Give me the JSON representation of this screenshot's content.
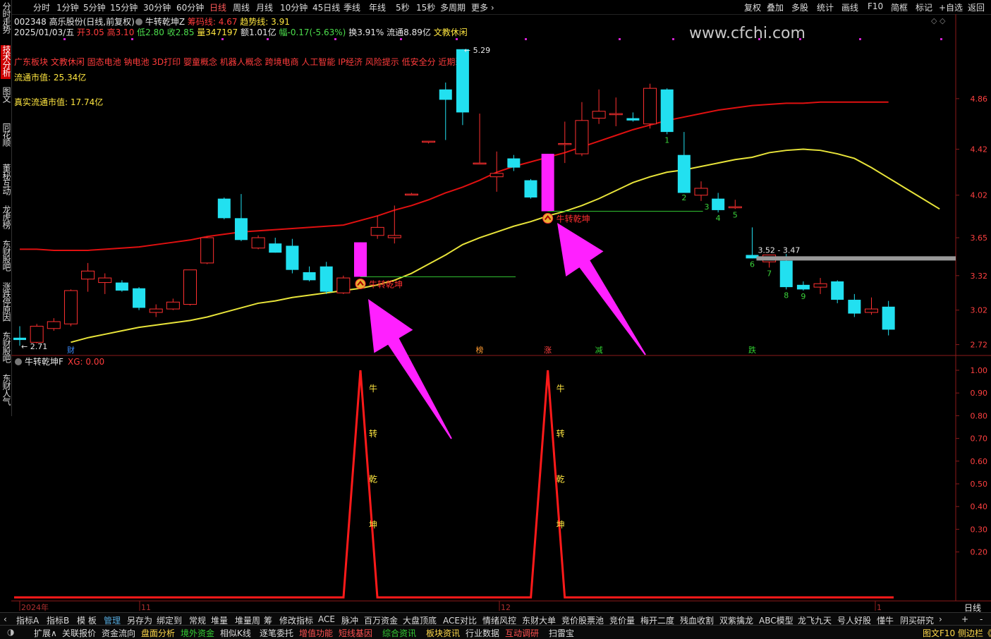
{
  "toolbar": {
    "periods": [
      "分时",
      "1分钟",
      "5分钟",
      "15分钟",
      "30分钟",
      "60分钟",
      "日线",
      "周线",
      "月线",
      "10分钟",
      "45日线",
      "季线",
      "年线",
      "5秒",
      "15秒",
      "多周期",
      "更多"
    ],
    "active_period": "日线",
    "right_buttons": [
      "复权",
      "叠加",
      "多股",
      "统计",
      "画线",
      "F10",
      "简框",
      "标记",
      "+自选",
      "返回"
    ]
  },
  "sidenav": {
    "items": [
      "分时走势",
      "技术分析",
      "图文10",
      "同花顺10",
      "董秘互动",
      "龙虎榜",
      "东财股吧",
      "涨跌停原因",
      "东财股吧",
      "东财人气"
    ],
    "active": "技术分析"
  },
  "stock": {
    "code_name": "002348 高乐股份(日线,前复权)",
    "indicator_title": "牛转乾坤Z",
    "chip_line_label": "筹码线: 4.67",
    "trend_line_label": "趋势线: 3.91",
    "date": "2025/01/03/五",
    "open": "开3.05",
    "high": "高3.10",
    "low": "低2.80",
    "close": "收2.85",
    "volume": "量347197",
    "amount": "额1.01亿",
    "change": "幅-0.17(-5.63%)",
    "turnover": "换3.91%",
    "float_cap": "流通8.89亿",
    "sector": "文教休闲",
    "concepts": "广东板块 文教休闲 固态电池 钠电池 3D打印 婴童概念 机器人概念 跨境电商 人工智能 IP经济 风险提示 低安全分 近期弱",
    "float_mv": "流通市值: 25.34亿",
    "real_float_mv": "真实流通市值: 17.74亿",
    "watermark": "www.cfchi.com"
  },
  "main_chart": {
    "price_ticks": [
      "4.86",
      "4.42",
      "4.02",
      "3.65",
      "3.32",
      "3.02",
      "2.72"
    ],
    "high_label": "5.29",
    "low_label": "2.71",
    "range_label": "3.52 - 3.47",
    "signal_label": "牛转乾坤",
    "markers": [
      "财",
      "榜",
      "涨",
      "减",
      "跌"
    ],
    "counts": [
      "1",
      "2",
      "3",
      "4",
      "5",
      "6",
      "7",
      "8",
      "9"
    ]
  },
  "sub_chart": {
    "title": "牛转乾坤F",
    "xg_label": "XG: 0.00",
    "ticks": [
      "1.00",
      "0.90",
      "0.80",
      "0.70",
      "0.60",
      "0.50",
      "0.40",
      "0.30",
      "0.20"
    ],
    "peak_chars": [
      "牛",
      "转",
      "乾",
      "坤"
    ]
  },
  "time_axis": {
    "labels": [
      "2024年",
      "11",
      "12",
      "1"
    ],
    "period_button": "日线"
  },
  "indicator_tabs": [
    "指标A",
    "指标B",
    "模 板",
    "管理",
    "另存为",
    "绑定到",
    "常规",
    "堆量",
    "堆量周",
    "筹",
    "修改指标",
    "ACE",
    "脉冲",
    "百万资金",
    "大盘顶底",
    "ACE对比",
    "情绪风控",
    "东财大单",
    "竞价股票池",
    "竞价量",
    "梅开二度",
    "残血收割",
    "双紫擒龙",
    "ABC模型",
    "龙飞九天",
    "号人好股",
    "懂牛",
    "阴买研究"
  ],
  "active_indicator_tab": "管理",
  "bottom_bar": {
    "items": [
      "扩展∧",
      "关联报价",
      "资金流向",
      "盘面分析",
      "境外资金",
      "相似K线",
      "逐笔委托",
      "增值功能",
      "短线基因",
      "综合资讯",
      "板块资讯",
      "行业数据",
      "互动调研",
      "扫雷宝"
    ],
    "right": "图文F10 侧边栏《"
  },
  "chart_data": [
    {
      "type": "candlestick",
      "title": "002348 高乐股份(日线,前复权)",
      "ylim": [
        2.65,
        5.35
      ],
      "candles": [
        {
          "o": 2.78,
          "h": 2.88,
          "l": 2.71,
          "c": 2.76
        },
        {
          "o": 2.74,
          "h": 2.9,
          "l": 2.73,
          "c": 2.88
        },
        {
          "o": 2.86,
          "h": 2.95,
          "l": 2.84,
          "c": 2.92
        },
        {
          "o": 2.9,
          "h": 3.2,
          "l": 2.88,
          "c": 3.19
        },
        {
          "o": 3.29,
          "h": 3.43,
          "l": 3.18,
          "c": 3.36
        },
        {
          "o": 3.26,
          "h": 3.34,
          "l": 3.16,
          "c": 3.3
        },
        {
          "o": 3.26,
          "h": 3.28,
          "l": 3.18,
          "c": 3.19
        },
        {
          "o": 3.21,
          "h": 3.22,
          "l": 3.02,
          "c": 3.04
        },
        {
          "o": 3.0,
          "h": 3.07,
          "l": 2.96,
          "c": 3.03
        },
        {
          "o": 3.03,
          "h": 3.12,
          "l": 3.02,
          "c": 3.09
        },
        {
          "o": 3.07,
          "h": 3.37,
          "l": 3.06,
          "c": 3.37
        },
        {
          "o": 3.43,
          "h": 3.66,
          "l": 3.42,
          "c": 3.65
        },
        {
          "o": 3.99,
          "h": 4.0,
          "l": 3.81,
          "c": 3.82
        },
        {
          "o": 3.82,
          "h": 4.03,
          "l": 3.62,
          "c": 3.63
        },
        {
          "o": 3.56,
          "h": 3.67,
          "l": 3.55,
          "c": 3.65
        },
        {
          "o": 3.6,
          "h": 3.65,
          "l": 3.52,
          "c": 3.52
        },
        {
          "o": 3.58,
          "h": 3.64,
          "l": 3.34,
          "c": 3.37
        },
        {
          "o": 3.35,
          "h": 3.4,
          "l": 3.27,
          "c": 3.28
        },
        {
          "o": 3.4,
          "h": 3.44,
          "l": 3.16,
          "c": 3.18
        },
        {
          "o": 3.17,
          "h": 3.32,
          "l": 3.16,
          "c": 3.3
        },
        {
          "o": 3.31,
          "h": 3.61,
          "l": 3.31,
          "c": 3.61
        },
        {
          "o": 3.67,
          "h": 3.84,
          "l": 3.64,
          "c": 3.74
        },
        {
          "o": 3.65,
          "h": 3.93,
          "l": 3.6,
          "c": 3.67
        },
        {
          "o": 4.03,
          "h": 4.04,
          "l": 4.02,
          "c": 4.03
        },
        {
          "o": 4.49,
          "h": 4.49,
          "l": 4.47,
          "c": 4.49
        },
        {
          "o": 4.94,
          "h": 5.0,
          "l": 4.5,
          "c": 4.85
        },
        {
          "o": 5.29,
          "h": 5.29,
          "l": 4.63,
          "c": 4.74
        },
        {
          "o": 4.3,
          "h": 4.73,
          "l": 4.3,
          "c": 4.3
        },
        {
          "o": 4.18,
          "h": 4.4,
          "l": 4.05,
          "c": 4.21
        },
        {
          "o": 4.34,
          "h": 4.37,
          "l": 4.23,
          "c": 4.26
        },
        {
          "o": 4.15,
          "h": 4.16,
          "l": 3.99,
          "c": 4.0
        },
        {
          "o": 3.88,
          "h": 4.38,
          "l": 3.88,
          "c": 4.38
        },
        {
          "o": 4.47,
          "h": 4.66,
          "l": 4.3,
          "c": 4.47
        },
        {
          "o": 4.38,
          "h": 4.83,
          "l": 4.36,
          "c": 4.67
        },
        {
          "o": 4.69,
          "h": 4.94,
          "l": 4.64,
          "c": 4.75
        },
        {
          "o": 4.72,
          "h": 4.87,
          "l": 4.62,
          "c": 4.73
        },
        {
          "o": 4.69,
          "h": 4.74,
          "l": 4.66,
          "c": 4.67
        },
        {
          "o": 4.64,
          "h": 4.99,
          "l": 4.6,
          "c": 4.95
        },
        {
          "o": 4.94,
          "h": 4.95,
          "l": 4.55,
          "c": 4.57
        },
        {
          "o": 4.37,
          "h": 4.57,
          "l": 4.05,
          "c": 4.04
        },
        {
          "o": 4.02,
          "h": 4.14,
          "l": 3.97,
          "c": 4.08
        },
        {
          "o": 3.99,
          "h": 4.04,
          "l": 3.87,
          "c": 3.89
        },
        {
          "o": 3.91,
          "h": 3.98,
          "l": 3.9,
          "c": 3.92
        },
        {
          "o": 3.5,
          "h": 3.74,
          "l": 3.47,
          "c": 3.47
        },
        {
          "o": 3.44,
          "h": 3.5,
          "l": 3.39,
          "c": 3.5
        },
        {
          "o": 3.45,
          "h": 3.51,
          "l": 3.2,
          "c": 3.22
        },
        {
          "o": 3.24,
          "h": 3.27,
          "l": 3.19,
          "c": 3.2
        },
        {
          "o": 3.22,
          "h": 3.3,
          "l": 3.16,
          "c": 3.25
        },
        {
          "o": 3.27,
          "h": 3.28,
          "l": 3.08,
          "c": 3.11
        },
        {
          "o": 3.11,
          "h": 3.16,
          "l": 2.96,
          "c": 2.99
        },
        {
          "o": 3.0,
          "h": 3.13,
          "l": 2.98,
          "c": 3.03
        },
        {
          "o": 3.05,
          "h": 3.1,
          "l": 2.8,
          "c": 2.85
        }
      ],
      "signal_candles": [
        20,
        31
      ],
      "ma_red": [
        3.55,
        3.55,
        3.54,
        3.54,
        3.54,
        3.55,
        3.56,
        3.57,
        3.59,
        3.61,
        3.63,
        3.66,
        3.68,
        3.7,
        3.71,
        3.72,
        3.73,
        3.74,
        3.75,
        3.76,
        3.8,
        3.84,
        3.89,
        3.93,
        3.98,
        4.04,
        4.09,
        4.15,
        4.22,
        4.27,
        4.31,
        4.35,
        4.39,
        4.44,
        4.49,
        4.54,
        4.59,
        4.63,
        4.67,
        4.7,
        4.73,
        4.76,
        4.78,
        4.8,
        4.81,
        4.82,
        4.82,
        4.83,
        4.83,
        4.83,
        4.83,
        4.83
      ],
      "ma_yellow": [
        2.74,
        2.78,
        2.81,
        2.84,
        2.87,
        2.89,
        2.91,
        2.93,
        2.96,
        3.0,
        3.04,
        3.08,
        3.1,
        3.13,
        3.15,
        3.17,
        3.19,
        3.21,
        3.24,
        3.28,
        3.34,
        3.42,
        3.5,
        3.59,
        3.65,
        3.7,
        3.75,
        3.79,
        3.84,
        3.88,
        3.93,
        3.99,
        4.06,
        4.13,
        4.18,
        4.22,
        4.24,
        4.27,
        4.3,
        4.33,
        4.35,
        4.39,
        4.41,
        4.42,
        4.41,
        4.38,
        4.34,
        4.26,
        4.17,
        4.08,
        3.99,
        3.9
      ]
    },
    {
      "type": "line",
      "title": "牛转乾坤F",
      "ylim": [
        0,
        1.0
      ],
      "peaks": [
        {
          "candle": 20,
          "value": 1.0
        },
        {
          "candle": 31,
          "value": 1.0
        }
      ],
      "baseline": 0
    }
  ]
}
